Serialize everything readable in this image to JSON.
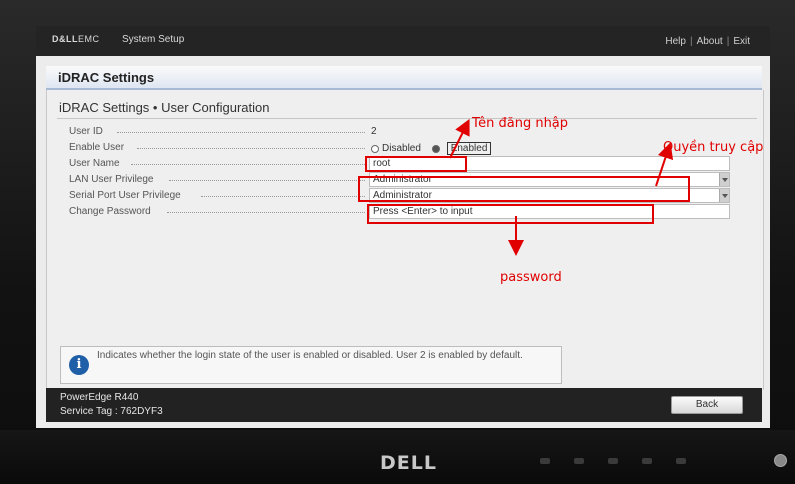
{
  "monitor": {
    "brand": "DELL"
  },
  "topbar": {
    "brand_bold": "D&LL",
    "brand_emc": "EMC",
    "title": "System Setup",
    "links": [
      "Help",
      "About",
      "Exit"
    ]
  },
  "section": {
    "title": "iDRAC Settings"
  },
  "page": {
    "title": "iDRAC Settings • User Configuration"
  },
  "fields": {
    "user_id": {
      "label": "User ID",
      "value": "2"
    },
    "enable_user": {
      "label": "Enable User",
      "option_disabled": "Disabled",
      "option_enabled": "Enabled",
      "selected": "Enabled"
    },
    "user_name": {
      "label": "User Name",
      "value": "root"
    },
    "lan_priv": {
      "label": "LAN User Privilege",
      "value": "Administrator"
    },
    "serial_priv": {
      "label": "Serial Port User Privilege",
      "value": "Administrator"
    },
    "change_pw": {
      "label": "Change Password",
      "value": "Press <Enter> to input"
    }
  },
  "help": {
    "text": "Indicates whether the login state of the user is enabled or disabled. User 2 is enabled by default."
  },
  "footer": {
    "model": "PowerEdge R440",
    "service_tag": "Service Tag : 762DYF3",
    "back_label": "Back"
  },
  "annotations": {
    "username_note": "Tên đăng nhập",
    "privilege_note": "Quyền truy cập",
    "password_note": "password",
    "color": "#e10000"
  }
}
